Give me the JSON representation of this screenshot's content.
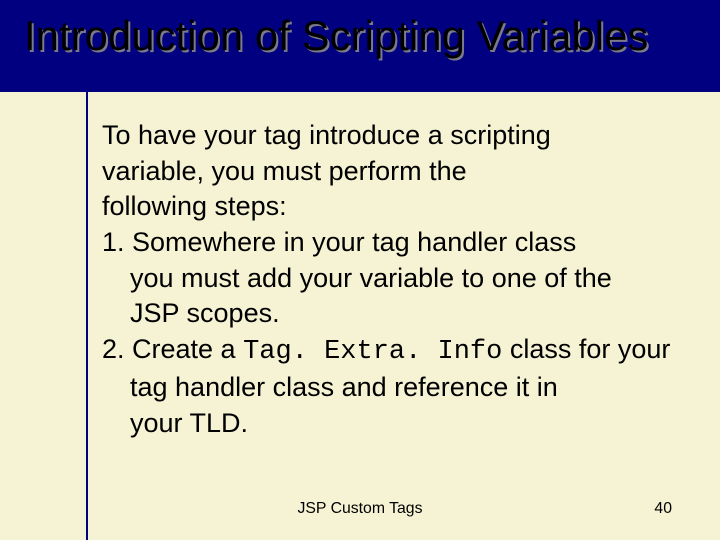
{
  "title": "Introduction of Scripting Variables",
  "intro_l1": "To have your tag introduce a scripting",
  "intro_l2": "variable, you must perform the",
  "intro_l3": "following steps:",
  "step1_l1": "1. Somewhere in your tag handler class",
  "step1_l2": "you must add your variable to one of the",
  "step1_l3": "JSP scopes.",
  "step2_l1_pre": "2. Create a ",
  "step2_code": "Tag. Extra. Info",
  "step2_l1_post": " class for your",
  "step2_l2": "tag handler class and reference it in",
  "step2_l3": "your TLD.",
  "footer_label": "JSP Custom Tags",
  "page_number": "40"
}
